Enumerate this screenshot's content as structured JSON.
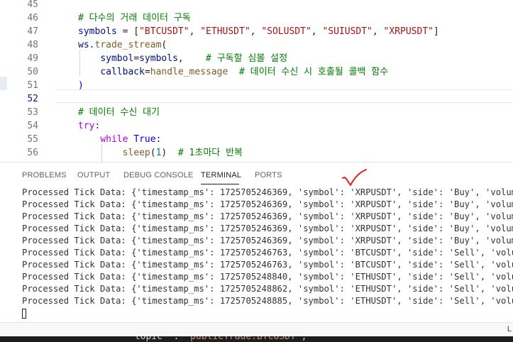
{
  "editor": {
    "lines": [
      {
        "num": "45",
        "tokens": []
      },
      {
        "num": "46",
        "tokens": [
          {
            "t": "# 다수의 거래 데이터 구독",
            "c": "c-comment"
          }
        ]
      },
      {
        "num": "47",
        "tokens": [
          {
            "t": "symbols",
            "c": "c-var"
          },
          {
            "t": " = [",
            "c": ""
          },
          {
            "t": "\"BTCUSDT\"",
            "c": "c-str"
          },
          {
            "t": ", ",
            "c": ""
          },
          {
            "t": "\"ETHUSDT\"",
            "c": "c-str"
          },
          {
            "t": ", ",
            "c": ""
          },
          {
            "t": "\"SOLUSDT\"",
            "c": "c-str"
          },
          {
            "t": ", ",
            "c": ""
          },
          {
            "t": "\"SUIUSDT\"",
            "c": "c-str"
          },
          {
            "t": ", ",
            "c": ""
          },
          {
            "t": "\"XRPUSDT\"",
            "c": "c-str"
          },
          {
            "t": "]",
            "c": ""
          }
        ]
      },
      {
        "num": "48",
        "tokens": [
          {
            "t": "ws",
            "c": "c-var"
          },
          {
            "t": ".",
            "c": ""
          },
          {
            "t": "trade_stream",
            "c": "c-fn"
          },
          {
            "t": "(",
            "c": ""
          }
        ]
      },
      {
        "num": "49",
        "tokens": [
          {
            "t": "    ",
            "c": ""
          },
          {
            "t": "symbol",
            "c": "c-var"
          },
          {
            "t": "=",
            "c": ""
          },
          {
            "t": "symbols",
            "c": "c-var"
          },
          {
            "t": ",    ",
            "c": ""
          },
          {
            "t": "# 구독할 심볼 설정",
            "c": "c-comment"
          }
        ]
      },
      {
        "num": "50",
        "tokens": [
          {
            "t": "    ",
            "c": ""
          },
          {
            "t": "callback",
            "c": "c-var"
          },
          {
            "t": "=",
            "c": ""
          },
          {
            "t": "handle_message",
            "c": "c-fn"
          },
          {
            "t": "  ",
            "c": ""
          },
          {
            "t": "# 데이터 수신 시 호출될 콜백 함수",
            "c": "c-comment"
          }
        ]
      },
      {
        "num": "51",
        "tokens": [
          {
            "t": ")",
            "c": "c-const"
          }
        ]
      },
      {
        "num": "52",
        "tokens": []
      },
      {
        "num": "53",
        "tokens": [
          {
            "t": "# 데이터 수신 대기",
            "c": "c-comment"
          }
        ]
      },
      {
        "num": "54",
        "tokens": [
          {
            "t": "try",
            "c": "c-kw"
          },
          {
            "t": ":",
            "c": ""
          }
        ]
      },
      {
        "num": "55",
        "tokens": [
          {
            "t": "    ",
            "c": ""
          },
          {
            "t": "while",
            "c": "c-kw"
          },
          {
            "t": " ",
            "c": ""
          },
          {
            "t": "True",
            "c": "c-const"
          },
          {
            "t": ":",
            "c": ""
          }
        ]
      },
      {
        "num": "56",
        "tokens": [
          {
            "t": "        ",
            "c": ""
          },
          {
            "t": "sleep",
            "c": "c-fn"
          },
          {
            "t": "(",
            "c": ""
          },
          {
            "t": "1",
            "c": "c-num"
          },
          {
            "t": ")  ",
            "c": ""
          },
          {
            "t": "# 1초마다 반복",
            "c": "c-comment"
          }
        ]
      }
    ]
  },
  "panel": {
    "tabs": [
      "PROBLEMS",
      "OUTPUT",
      "DEBUG CONSOLE",
      "TERMINAL",
      "PORTS"
    ],
    "active_tab": "TERMINAL",
    "terminal_lines": [
      "Processed Tick Data: {'timestamp_ms': 1725705246369, 'symbol': 'XRPUSDT', 'side': 'Buy', 'volume_ba",
      "Processed Tick Data: {'timestamp_ms': 1725705246369, 'symbol': 'XRPUSDT', 'side': 'Buy', 'volume_ba",
      "Processed Tick Data: {'timestamp_ms': 1725705246369, 'symbol': 'XRPUSDT', 'side': 'Buy', 'volume_ba",
      "Processed Tick Data: {'timestamp_ms': 1725705246369, 'symbol': 'XRPUSDT', 'side': 'Buy', 'volume_ba",
      "Processed Tick Data: {'timestamp_ms': 1725705246369, 'symbol': 'XRPUSDT', 'side': 'Buy', 'volume_ba",
      "Processed Tick Data: {'timestamp_ms': 1725705246763, 'symbol': 'BTCUSDT', 'side': 'Sell', 'volume_b",
      "Processed Tick Data: {'timestamp_ms': 1725705246763, 'symbol': 'BTCUSDT', 'side': 'Sell', 'volume_b",
      "Processed Tick Data: {'timestamp_ms': 1725705248840, 'symbol': 'ETHUSDT', 'side': 'Sell', 'volume_b",
      "Processed Tick Data: {'timestamp_ms': 1725705248862, 'symbol': 'ETHUSDT', 'side': 'Sell', 'volume_b",
      "Processed Tick Data: {'timestamp_ms': 1725705248885, 'symbol': 'ETHUSDT', 'side': 'Sell', 'volume_b"
    ],
    "annotation_icon": "red-checkmark-icon",
    "annotation_color": "#e02020"
  },
  "statusbar": {
    "right_text": "L"
  },
  "bottom": {
    "key": "topic",
    "value": "publicTrade.BTCUSDT"
  }
}
